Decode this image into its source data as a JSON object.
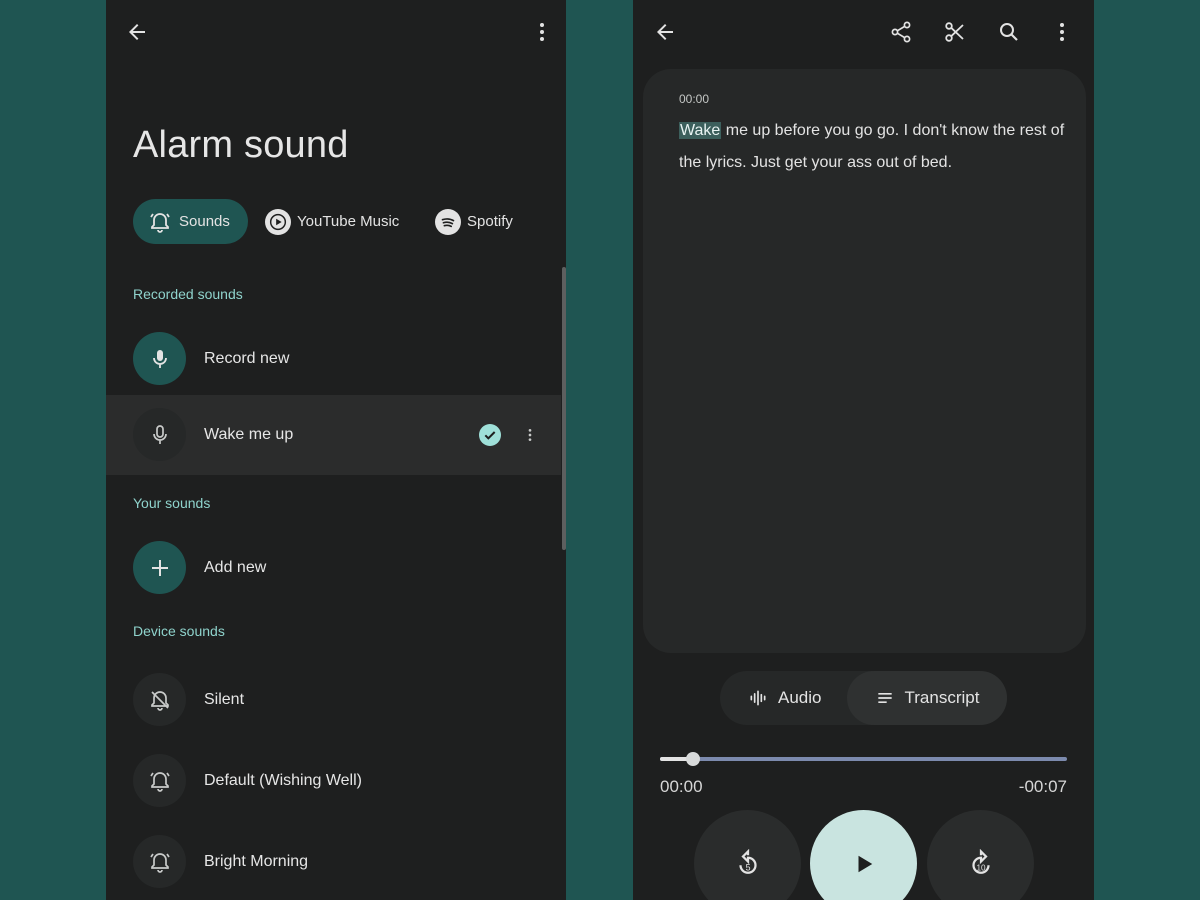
{
  "left": {
    "title": "Alarm sound",
    "chips": [
      {
        "label": "Sounds",
        "icon": "alarm-bell-icon",
        "selected": true
      },
      {
        "label": "YouTube Music",
        "icon": "youtube-music-icon"
      },
      {
        "label": "Spotify",
        "icon": "spotify-icon"
      }
    ],
    "sections": {
      "recorded": "Recorded sounds",
      "yours": "Your sounds",
      "device": "Device sounds"
    },
    "recorded": [
      {
        "label": "Record new",
        "icon": "microphone-icon"
      },
      {
        "label": "Wake me up",
        "icon": "microphone-icon",
        "selected": true
      }
    ],
    "yours": [
      {
        "label": "Add new",
        "icon": "plus-icon"
      }
    ],
    "device": [
      {
        "label": "Silent",
        "icon": "bell-off-icon"
      },
      {
        "label": "Default (Wishing Well)",
        "icon": "alarm-bell-icon"
      },
      {
        "label": "Bright Morning",
        "icon": "alarm-bell-icon"
      }
    ]
  },
  "right": {
    "timestamp": "00:00",
    "highlight_word": "Wake",
    "transcript_rest": " me up before you go go. I don't know the rest of the lyrics. Just get your ass out of bed.",
    "segments": {
      "audio": "Audio",
      "transcript": "Transcript",
      "selected": "transcript"
    },
    "player": {
      "elapsed": "00:00",
      "remaining": "-00:07",
      "progress_fraction": 0.08,
      "rewind_seconds": "5",
      "forward_seconds": "10"
    }
  },
  "colors": {
    "background": "#1f5552",
    "panel": "#1e1f1f",
    "accent": "#8fd3cc",
    "check": "#9fe0d9",
    "track": "#7c8aad"
  }
}
